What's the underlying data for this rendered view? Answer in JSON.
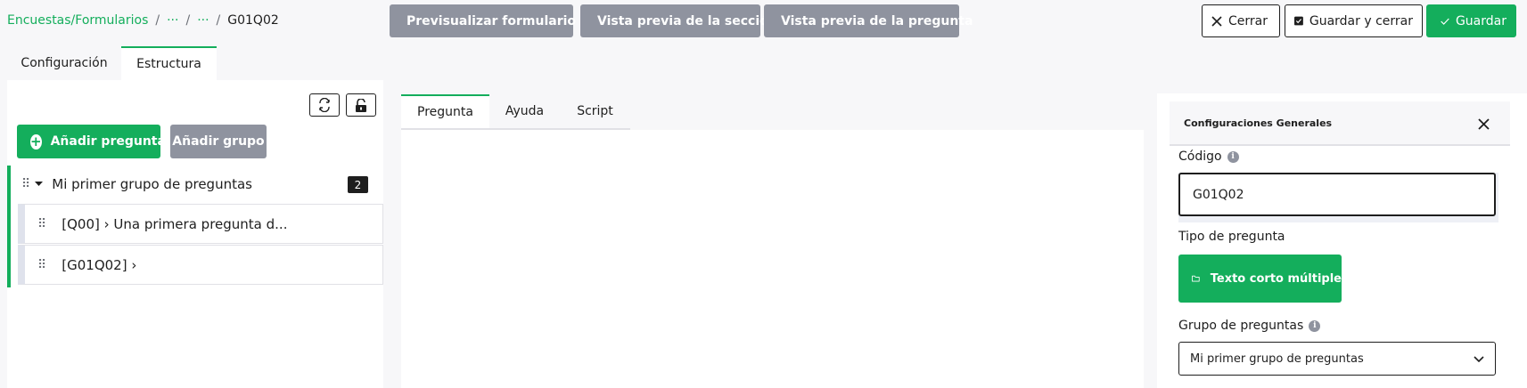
{
  "breadcrumb": {
    "root": "Encuestas/Formularios",
    "ellipsis1": "···",
    "ellipsis2": "···",
    "separator": "/",
    "current": "G01Q02"
  },
  "preview_buttons": [
    {
      "label": "Previsualizar formulario",
      "icon": "eye-icon"
    },
    {
      "label": "Vista previa de la sección",
      "icon": "eye-icon"
    },
    {
      "label": "Vista previa de la pregunta",
      "icon": "eye-icon"
    }
  ],
  "actions": {
    "close_label": "Cerrar",
    "save_close_label": "Guardar y cerrar",
    "save_label": "Guardar"
  },
  "main_tabs": [
    {
      "label": "Configuración",
      "active": false
    },
    {
      "label": "Estructura",
      "active": true
    }
  ],
  "structure": {
    "add_question_label": "Añadir pregunta",
    "add_group_label": "Añadir grupo",
    "group": {
      "title": "Mi primer grupo de preguntas",
      "count": "2",
      "questions": [
        {
          "label": "[Q00] › Una primera pregunta d..."
        },
        {
          "label": "[G01Q02] ›"
        }
      ]
    }
  },
  "editor_tabs": [
    {
      "label": "Pregunta",
      "active": true
    },
    {
      "label": "Ayuda",
      "active": false
    },
    {
      "label": "Script",
      "active": false
    }
  ],
  "settings": {
    "title": "Configuraciones Generales",
    "code_label": "Código",
    "code_value": "G01Q02",
    "qtype_label": "Tipo de pregunta",
    "qtype_value": "Texto corto múltiple",
    "group_label": "Grupo de preguntas",
    "group_value": "Mi primer grupo de preguntas"
  },
  "colors": {
    "accent": "#14ae5c",
    "muted_button": "#8f939f",
    "text": "#1e1e1e",
    "background": "#f7f7f9"
  }
}
